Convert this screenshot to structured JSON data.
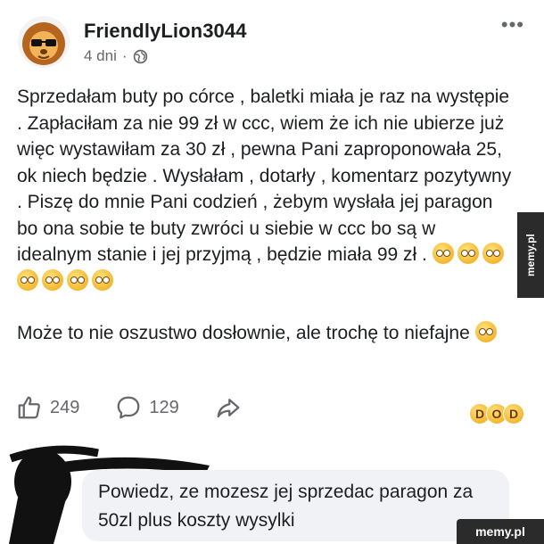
{
  "post": {
    "author": "FriendlyLion3044",
    "time": "4 dni",
    "separator": "·",
    "more": "•••",
    "text_p1": "Sprzedałam buty po córce , baletki miała je raz na występie . Zapłaciłam za nie 99 zł w ccc, wiem że ich nie ubierze już więc wystawiłam za 30 zł , pewna Pani zaproponowała 25, ok niech będzie . Wysłałam , dotarły , komentarz pozytywny . Piszę do mnie Pani codzień , żebym wysłała jej paragon bo ona sobie te buty zwróci u siebie w ccc bo są w idealnym stanie i jej przyjmą , będzie miała 99 zł .",
    "text_p2": "Może to nie oszustwo dosłownie, ale trochę to niefajne"
  },
  "icons": {
    "avatar": "lion-sunglasses-avatar",
    "audience": "globe-icon",
    "like": "thumbs-up-icon",
    "comment": "comment-bubble-icon",
    "share": "share-arrow-icon"
  },
  "actions": {
    "likes": "249",
    "comments": "129"
  },
  "reactions": [
    "😆",
    "😮",
    "😂"
  ],
  "comment": {
    "text": "Powiedz, ze mozesz jej sprzedac paragon za 50zl plus koszty wysylki"
  },
  "watermark": {
    "side": "memy.pl",
    "corner": "memy.pl"
  },
  "colors": {
    "text": "#1c1e21",
    "secondary": "#65676b",
    "comment_bg": "#f0f2f5",
    "watermark_bg": "#2b2b2b"
  }
}
